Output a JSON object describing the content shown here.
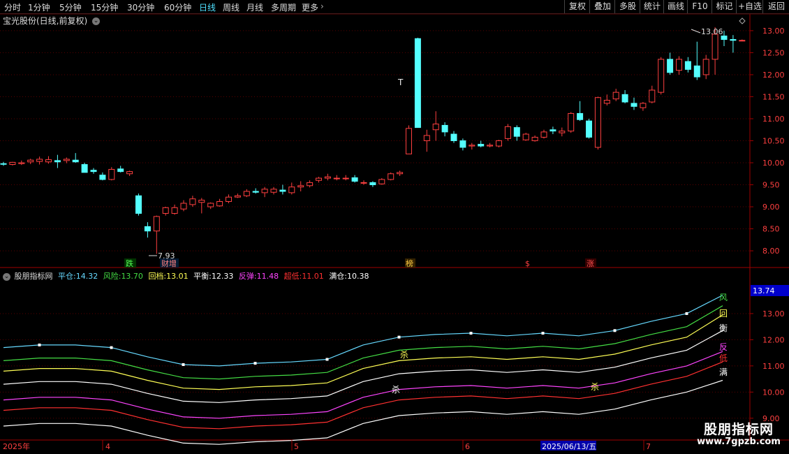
{
  "toolbar": {
    "periods": [
      "分时",
      "1分钟",
      "5分钟",
      "15分钟",
      "30分钟",
      "60分钟",
      "日线",
      "周线",
      "月线",
      "多周期",
      "更多"
    ],
    "active_period": "日线",
    "right_buttons": [
      "复权",
      "叠加",
      "多股",
      "统计",
      "画线",
      "F10",
      "标记",
      "+自选",
      "返回"
    ]
  },
  "stock": {
    "title": "宝光股份(日线,前复权)"
  },
  "indicator": {
    "name": "股朋指标网",
    "items": [
      {
        "label": "平仓:",
        "value": "14.32",
        "color": "#66d9ff"
      },
      {
        "label": "风险:",
        "value": "13.70",
        "color": "#44dd44"
      },
      {
        "label": "回档:",
        "value": "13.01",
        "color": "#ffff55"
      },
      {
        "label": "平衡:",
        "value": "12.33",
        "color": "#ffffff"
      },
      {
        "label": "反弹:",
        "value": "11.48",
        "color": "#ff44ff"
      },
      {
        "label": "超低:",
        "value": "11.01",
        "color": "#ff3030"
      },
      {
        "label": "满仓:",
        "value": "10.38",
        "color": "#ffffff"
      }
    ],
    "current_value": "13.74",
    "line_tags": [
      "风",
      "回",
      "衡",
      "反",
      "低",
      "满"
    ],
    "signal_tags": [
      "杀",
      "杀",
      "杀"
    ]
  },
  "price_axis": [
    "13.00",
    "12.50",
    "12.00",
    "11.50",
    "11.00",
    "10.50",
    "10.00",
    "9.50",
    "9.00",
    "8.50",
    "8.00"
  ],
  "ind_axis": [
    "13.00",
    "12.00",
    "11.00",
    "10.00",
    "9.00"
  ],
  "annotations": {
    "high_label": "13.06",
    "low_label": "7.93",
    "t_mark": "T",
    "events": [
      "跌",
      "财增",
      "榜",
      "$",
      "涨"
    ]
  },
  "date_axis": {
    "labels": [
      "2025年",
      "4",
      "5",
      "6",
      "7"
    ],
    "cursor_date": "2025/06/13/五"
  },
  "watermark": {
    "title": "股朋指标网",
    "url": "www.7gpzb.com"
  },
  "colors": {
    "up": "#ff4040",
    "down": "#54ffff",
    "grid": "#5a0000"
  },
  "chart_data": {
    "type": "candlestick",
    "series_ohlc": [
      [
        9.98,
        10.02,
        9.93,
        9.97
      ],
      [
        9.96,
        10.02,
        9.94,
        10.01
      ],
      [
        9.98,
        10.05,
        9.95,
        10.0
      ],
      [
        10.02,
        10.09,
        9.97,
        10.06
      ],
      [
        10.03,
        10.14,
        9.96,
        10.08
      ],
      [
        10.02,
        10.15,
        9.98,
        10.07
      ],
      [
        10.05,
        10.18,
        9.88,
        10.02
      ],
      [
        10.05,
        10.12,
        9.99,
        10.08
      ],
      [
        10.06,
        10.22,
        10.0,
        10.02
      ],
      [
        9.96,
        10.0,
        9.78,
        9.78
      ],
      [
        9.83,
        9.88,
        9.75,
        9.8
      ],
      [
        9.72,
        9.78,
        9.6,
        9.62
      ],
      [
        9.62,
        9.9,
        9.6,
        9.85
      ],
      [
        9.86,
        9.93,
        9.78,
        9.8
      ],
      [
        9.75,
        9.82,
        9.7,
        9.8
      ],
      [
        9.25,
        9.3,
        8.8,
        8.85
      ],
      [
        8.55,
        8.65,
        8.3,
        8.45
      ],
      [
        8.45,
        8.8,
        7.93,
        8.78
      ],
      [
        8.85,
        9.0,
        8.8,
        8.98
      ],
      [
        8.85,
        9.05,
        8.82,
        8.98
      ],
      [
        8.95,
        9.15,
        8.9,
        9.08
      ],
      [
        9.05,
        9.25,
        9.0,
        9.18
      ],
      [
        9.1,
        9.2,
        8.85,
        9.15
      ],
      [
        9.0,
        9.1,
        8.95,
        9.08
      ],
      [
        9.02,
        9.18,
        9.0,
        9.12
      ],
      [
        9.12,
        9.28,
        9.08,
        9.22
      ],
      [
        9.22,
        9.3,
        9.2,
        9.25
      ],
      [
        9.25,
        9.4,
        9.22,
        9.35
      ],
      [
        9.35,
        9.42,
        9.3,
        9.33
      ],
      [
        9.32,
        9.45,
        9.22,
        9.4
      ],
      [
        9.33,
        9.45,
        9.28,
        9.4
      ],
      [
        9.38,
        9.5,
        9.28,
        9.35
      ],
      [
        9.32,
        9.55,
        9.28,
        9.45
      ],
      [
        9.45,
        9.58,
        9.35,
        9.48
      ],
      [
        9.48,
        9.6,
        9.44,
        9.55
      ],
      [
        9.6,
        9.68,
        9.55,
        9.65
      ],
      [
        9.65,
        9.75,
        9.6,
        9.68
      ],
      [
        9.65,
        9.72,
        9.6,
        9.65
      ],
      [
        9.65,
        9.72,
        9.6,
        9.65
      ],
      [
        9.66,
        9.72,
        9.55,
        9.58
      ],
      [
        9.55,
        9.6,
        9.5,
        9.55
      ],
      [
        9.55,
        9.58,
        9.45,
        9.5
      ],
      [
        9.52,
        9.65,
        9.5,
        9.62
      ],
      [
        9.62,
        9.78,
        9.6,
        9.75
      ],
      [
        9.75,
        9.82,
        9.7,
        9.78
      ],
      [
        10.2,
        10.85,
        10.2,
        10.78
      ],
      [
        12.82,
        12.84,
        10.8,
        10.8
      ],
      [
        10.5,
        10.75,
        10.25,
        10.62
      ],
      [
        10.75,
        11.17,
        10.5,
        10.88
      ],
      [
        10.85,
        10.92,
        10.6,
        10.7
      ],
      [
        10.65,
        10.72,
        10.45,
        10.5
      ],
      [
        10.5,
        10.55,
        10.28,
        10.35
      ],
      [
        10.38,
        10.45,
        10.3,
        10.4
      ],
      [
        10.42,
        10.5,
        10.35,
        10.38
      ],
      [
        10.38,
        10.45,
        10.35,
        10.4
      ],
      [
        10.38,
        10.52,
        10.35,
        10.5
      ],
      [
        10.55,
        10.88,
        10.5,
        10.82
      ],
      [
        10.8,
        10.85,
        10.5,
        10.6
      ],
      [
        10.52,
        10.68,
        10.5,
        10.65
      ],
      [
        10.5,
        10.62,
        10.48,
        10.58
      ],
      [
        10.58,
        10.75,
        10.55,
        10.7
      ],
      [
        10.75,
        10.82,
        10.65,
        10.72
      ],
      [
        10.68,
        10.8,
        10.6,
        10.72
      ],
      [
        10.72,
        11.15,
        10.68,
        11.12
      ],
      [
        11.12,
        11.4,
        10.95,
        10.98
      ],
      [
        10.95,
        11.0,
        10.55,
        10.58
      ],
      [
        10.35,
        11.5,
        10.3,
        11.48
      ],
      [
        11.35,
        11.55,
        11.3,
        11.42
      ],
      [
        11.45,
        11.68,
        11.4,
        11.6
      ],
      [
        11.55,
        11.65,
        11.35,
        11.38
      ],
      [
        11.35,
        11.48,
        11.2,
        11.28
      ],
      [
        11.25,
        11.38,
        11.18,
        11.35
      ],
      [
        11.38,
        11.75,
        11.35,
        11.65
      ],
      [
        11.6,
        12.4,
        11.55,
        12.35
      ],
      [
        12.35,
        12.5,
        12.0,
        12.05
      ],
      [
        12.1,
        12.42,
        12.0,
        12.35
      ],
      [
        12.3,
        12.4,
        12.05,
        12.12
      ],
      [
        12.2,
        12.75,
        11.88,
        11.95
      ],
      [
        12.0,
        12.45,
        11.9,
        12.35
      ],
      [
        12.35,
        13.08,
        12.0,
        12.92
      ],
      [
        12.88,
        13.0,
        12.65,
        12.8
      ],
      [
        12.8,
        12.9,
        12.5,
        12.78
      ],
      [
        12.78,
        12.8,
        12.76,
        12.78
      ]
    ],
    "price_ylim": [
      7.7,
      13.3
    ],
    "indicator_series": [
      {
        "name": "平仓",
        "last": 14.32,
        "values": [
          11.7,
          11.8,
          11.8,
          11.7,
          11.35,
          11.05,
          11.0,
          11.1,
          11.15,
          11.25,
          11.8,
          12.1,
          12.2,
          12.25,
          12.15,
          12.25,
          12.15,
          12.35,
          12.7,
          13.0,
          13.7
        ]
      },
      {
        "name": "风险",
        "last": 13.7,
        "values": [
          11.2,
          11.3,
          11.3,
          11.2,
          10.85,
          10.55,
          10.5,
          10.6,
          10.65,
          10.75,
          11.3,
          11.6,
          11.7,
          11.75,
          11.65,
          11.75,
          11.65,
          11.85,
          12.2,
          12.5,
          13.3
        ]
      },
      {
        "name": "回档",
        "last": 13.01,
        "values": [
          10.8,
          10.9,
          10.9,
          10.8,
          10.45,
          10.15,
          10.1,
          10.2,
          10.25,
          10.35,
          10.9,
          11.2,
          11.3,
          11.35,
          11.25,
          11.35,
          11.25,
          11.45,
          11.8,
          12.1,
          12.95
        ]
      },
      {
        "name": "平衡",
        "last": 12.33,
        "values": [
          10.3,
          10.4,
          10.4,
          10.3,
          9.95,
          9.65,
          9.6,
          9.7,
          9.75,
          9.85,
          10.4,
          10.7,
          10.8,
          10.85,
          10.75,
          10.85,
          10.75,
          10.95,
          11.3,
          11.6,
          12.35
        ]
      },
      {
        "name": "反弹",
        "last": 11.48,
        "values": [
          9.7,
          9.8,
          9.8,
          9.7,
          9.35,
          9.05,
          9.0,
          9.1,
          9.15,
          9.25,
          9.8,
          10.1,
          10.2,
          10.25,
          10.15,
          10.25,
          10.15,
          10.35,
          10.7,
          11.0,
          11.55
        ]
      },
      {
        "name": "超低",
        "last": 11.01,
        "values": [
          9.3,
          9.4,
          9.4,
          9.3,
          8.95,
          8.65,
          8.6,
          8.7,
          8.75,
          8.85,
          9.4,
          9.7,
          9.8,
          9.85,
          9.75,
          9.85,
          9.75,
          9.95,
          10.3,
          10.6,
          11.15
        ]
      },
      {
        "name": "满仓",
        "last": 10.38,
        "values": [
          8.7,
          8.8,
          8.8,
          8.7,
          8.35,
          8.05,
          8.0,
          8.1,
          8.15,
          8.25,
          8.8,
          9.1,
          9.2,
          9.25,
          9.15,
          9.25,
          9.15,
          9.35,
          9.7,
          10.0,
          10.45
        ]
      }
    ],
    "ind_ylim": [
      8.3,
      14.2
    ]
  }
}
